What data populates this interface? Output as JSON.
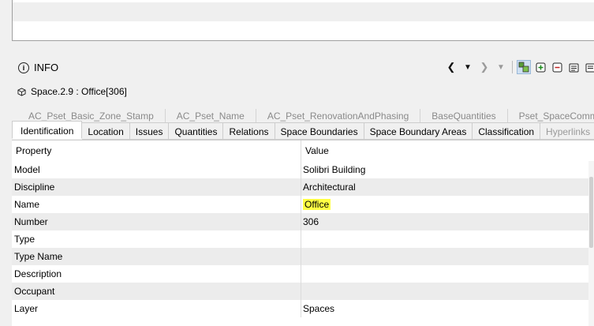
{
  "info": {
    "title": "INFO",
    "subtitle": "Space.2.9 : Office[306]"
  },
  "toolbar": {
    "icons": [
      "chevron-left-icon",
      "dropdown-icon",
      "chevron-right-icon",
      "dropdown-icon",
      "select-components-icon",
      "add-icon",
      "remove-icon",
      "list-add-icon",
      "list-icon"
    ]
  },
  "tabs_row1": [
    "AC_Pset_Basic_Zone_Stamp",
    "AC_Pset_Name",
    "AC_Pset_RenovationAndPhasing",
    "BaseQuantities",
    "Pset_SpaceCommon"
  ],
  "tabs_row2": [
    {
      "label": "Identification",
      "active": true
    },
    {
      "label": "Location"
    },
    {
      "label": "Issues"
    },
    {
      "label": "Quantities"
    },
    {
      "label": "Relations"
    },
    {
      "label": "Space Boundaries"
    },
    {
      "label": "Space Boundary Areas"
    },
    {
      "label": "Classification"
    },
    {
      "label": "Hyperlinks",
      "disabled": true
    }
  ],
  "table": {
    "columns": {
      "property": "Property",
      "value": "Value"
    },
    "rows": [
      {
        "property": "Model",
        "value": "Solibri Building"
      },
      {
        "property": "Discipline",
        "value": "Architectural"
      },
      {
        "property": "Name",
        "value": "Office",
        "highlight": true
      },
      {
        "property": "Number",
        "value": "306"
      },
      {
        "property": "Type",
        "value": ""
      },
      {
        "property": "Type Name",
        "value": ""
      },
      {
        "property": "Description",
        "value": ""
      },
      {
        "property": "Occupant",
        "value": ""
      },
      {
        "property": "Layer",
        "value": "Spaces"
      }
    ]
  },
  "colors": {
    "highlight": "#ffff44",
    "selected_tool": "#cfe0f2"
  }
}
